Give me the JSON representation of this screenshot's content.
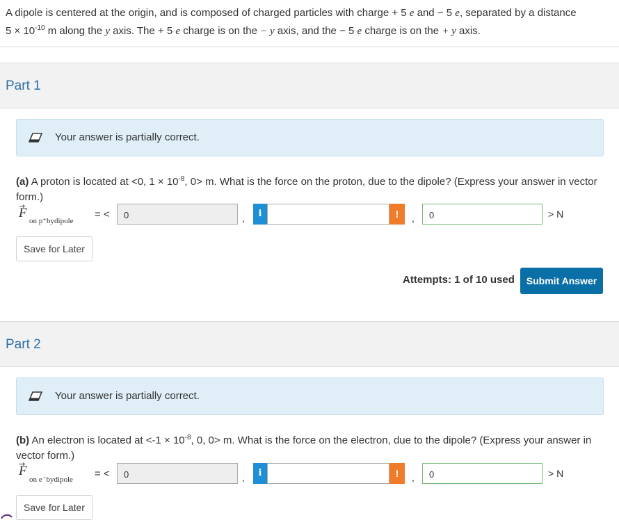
{
  "intro": {
    "line1_a": "A dipole is centered at the origin, and is composed of charged particles with charge",
    "plus5e": "+ 5",
    "e1": "e",
    "and": "and",
    "minus5e": "− 5",
    "e2": "e",
    "line1_b": ", separated by a distance",
    "dist_base": "5 × 10",
    "dist_exp": "-10",
    "line2_a": "m along the",
    "y1": "y",
    "line2_b": "axis. The",
    "plus5e_b": "+ 5",
    "e3": "e",
    "line2_c": "charge is on the",
    "neg_y": "− y",
    "line2_d": "axis, and the",
    "minus5e_b": "− 5",
    "e4": "e",
    "line2_e": "charge is on the",
    "pos_y": "+ y",
    "line2_f": "axis."
  },
  "part1": {
    "title": "Part 1",
    "alert": "Your answer is partially correct.",
    "q_label": "(a)",
    "q_text_a": "A proton is located at <0, 1 × 10",
    "q_exp": "-8",
    "q_text_b": ", 0> m. What is the force on the proton, due to the dipole? (Express your answer in vector form.)",
    "vec_symbol": "F",
    "vec_subscript": "on p⁺bydipole",
    "eq": "= <",
    "field1_value": "0",
    "field2_value": "",
    "field3_value": "0",
    "unit": "> N",
    "save_label": "Save for Later",
    "attempts": "Attempts: 1 of 10 used",
    "submit_label": "Submit Answer"
  },
  "part2": {
    "title": "Part 2",
    "alert": "Your answer is partially correct.",
    "q_label": "(b)",
    "q_text_a": "An electron is located at <-1 × 10",
    "q_exp": "-8",
    "q_text_b": ", 0, 0> m. What is the force on the electron, due to the dipole? (Express your answer in vector form.)",
    "vec_symbol": "F",
    "vec_subscript": "on e⁻bydipole",
    "eq": "= <",
    "field1_value": "0",
    "field2_value": "",
    "field3_value": "0",
    "unit": "> N",
    "save_label": "Save for Later"
  },
  "glyphs": {
    "info": "i",
    "warn": "!",
    "comma": ",",
    "arrow": "→"
  },
  "colors": {
    "accent": "#0a6fa6",
    "part_title": "#2a6ea8",
    "info_btn": "#1e8fd6",
    "warn_btn": "#f07c2a",
    "alert_bg": "#dfeef7"
  }
}
